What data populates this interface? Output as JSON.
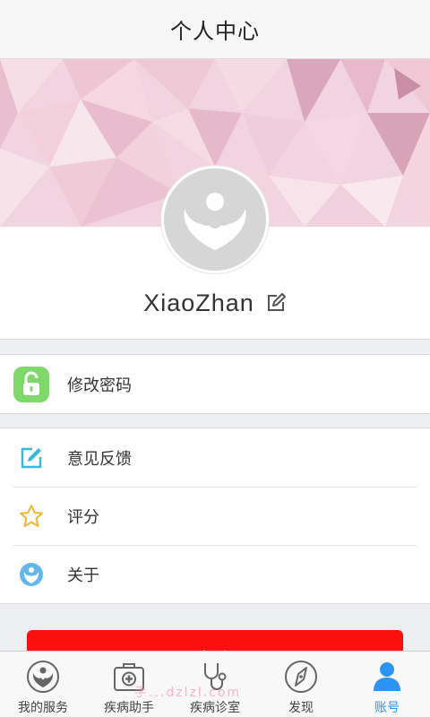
{
  "header": {
    "title": "个人中心"
  },
  "profile": {
    "username": "XiaoZhan"
  },
  "menu_groups": [
    {
      "items": [
        {
          "label": "修改密码",
          "icon": "unlock-icon"
        }
      ]
    },
    {
      "items": [
        {
          "label": "意见反馈",
          "icon": "feedback-edit-icon"
        },
        {
          "label": "评分",
          "icon": "star-icon"
        },
        {
          "label": "关于",
          "icon": "about-logo-icon"
        }
      ]
    }
  ],
  "logout": {
    "label": "退出账号"
  },
  "tabbar": {
    "tabs": [
      {
        "label": "我的服务",
        "icon": "service-logo-icon",
        "active": false
      },
      {
        "label": "疾病助手",
        "icon": "medical-kit-icon",
        "active": false
      },
      {
        "label": "疾病诊室",
        "icon": "stethoscope-icon",
        "active": false
      },
      {
        "label": "发现",
        "icon": "compass-icon",
        "active": false
      },
      {
        "label": "账号",
        "icon": "account-icon",
        "active": true
      }
    ]
  },
  "watermark": "手...dzlzl.com",
  "colors": {
    "accent": "#2b93f2",
    "logout": "#fb1010",
    "unlock": "#7fd96a",
    "feedback": "#3bb8d6",
    "star": "#f2b533",
    "about": "#63b7ee"
  }
}
